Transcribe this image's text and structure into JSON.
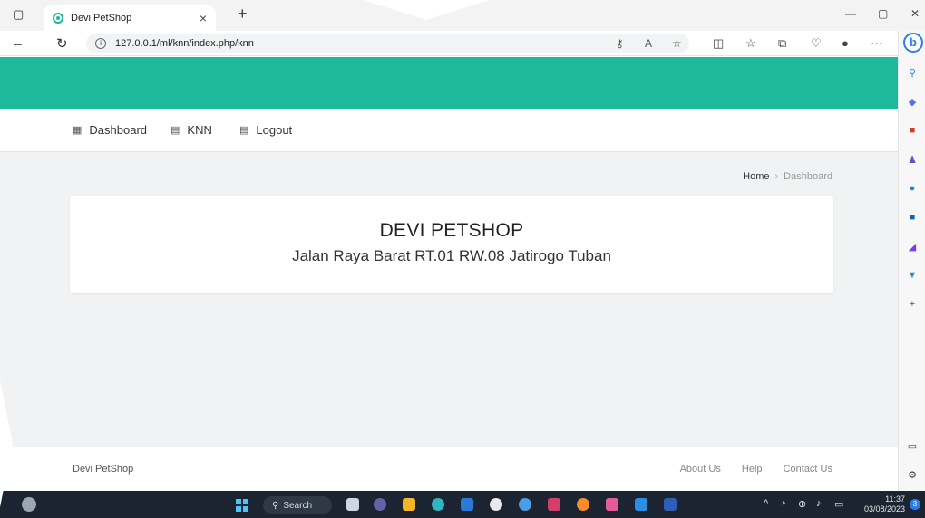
{
  "browser": {
    "tab_title": "Devi PetShop",
    "tab_close": "×",
    "new_tab": "+",
    "url": "127.0.0.1/ml/knn/index.php/knn",
    "window_controls": [
      "minimize-icon",
      "restore-icon",
      "close-icon"
    ]
  },
  "nav": {
    "menu": [
      {
        "label": "Dashboard",
        "icon": "grid-icon"
      },
      {
        "label": "KNN",
        "icon": "list-icon"
      },
      {
        "label": "Logout",
        "icon": "list-icon"
      }
    ]
  },
  "breadcrumb": {
    "home": "Home",
    "separator": "›",
    "current": "Dashboard"
  },
  "card": {
    "title": "DEVI PETSHOP",
    "address": "Jalan Raya Barat RT.01 RW.08 Jatirogo Tuban"
  },
  "footer": {
    "brand": "Devi PetShop",
    "links": [
      "About Us",
      "Help",
      "Contact Us"
    ]
  },
  "taskbar": {
    "search_label": "Search",
    "time": "11:37",
    "date": "03/08/2023",
    "notification_count": "3"
  },
  "colors": {
    "accent": "#1eb99b",
    "page_bg": "#f0f2f3",
    "taskbar": "#1b2430"
  }
}
